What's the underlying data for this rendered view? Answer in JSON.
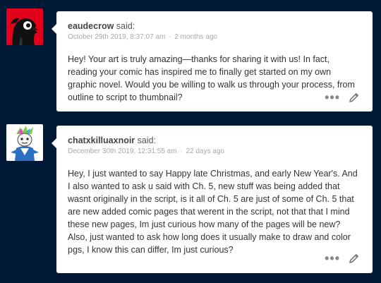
{
  "comments": [
    {
      "author": "eaudecrow",
      "said_label": "said:",
      "date": "October 29th 2019, 8:37:07 am",
      "separator": "·",
      "ago": "2 months ago",
      "body": "Hey! Your art is truly amazing—thanks for sharing it with us! In fact, reading your comic has inspired me to finally get started on my own graphic novel. Would you be willing to walk us through your process, from outline to script to thumbnail?",
      "avatar_bg": "#e3001b"
    },
    {
      "author": "chatxkilluaxnoir",
      "said_label": "said:",
      "date": "December 30th 2019, 12:31:55 am",
      "separator": "·",
      "ago": "22 days ago",
      "body": "Hey, I just wanted to say Happy late Christmas, and early New Year's. And I also wanted to ask u said with Ch. 5, new stuff was being added that wasnt originally in the script, is it all of Ch. 5 are just of some of Ch. 5 that are new added comic pages that werent in the script, not that that I mind these new pages, Im just curious how many of the pages will be new? Also, just wanted to ask how long does it usually make to draw and color pgs, I know this can differ, Im just curious?",
      "avatar_bg": "#ffffff"
    }
  ],
  "actions": {
    "more_icon": "more-icon",
    "more_glyph": "•••",
    "edit_icon": "pencil-icon"
  },
  "colors": {
    "page_bg": "#001935",
    "card_bg": "#ffffff",
    "meta_text": "#a8a8a8"
  }
}
